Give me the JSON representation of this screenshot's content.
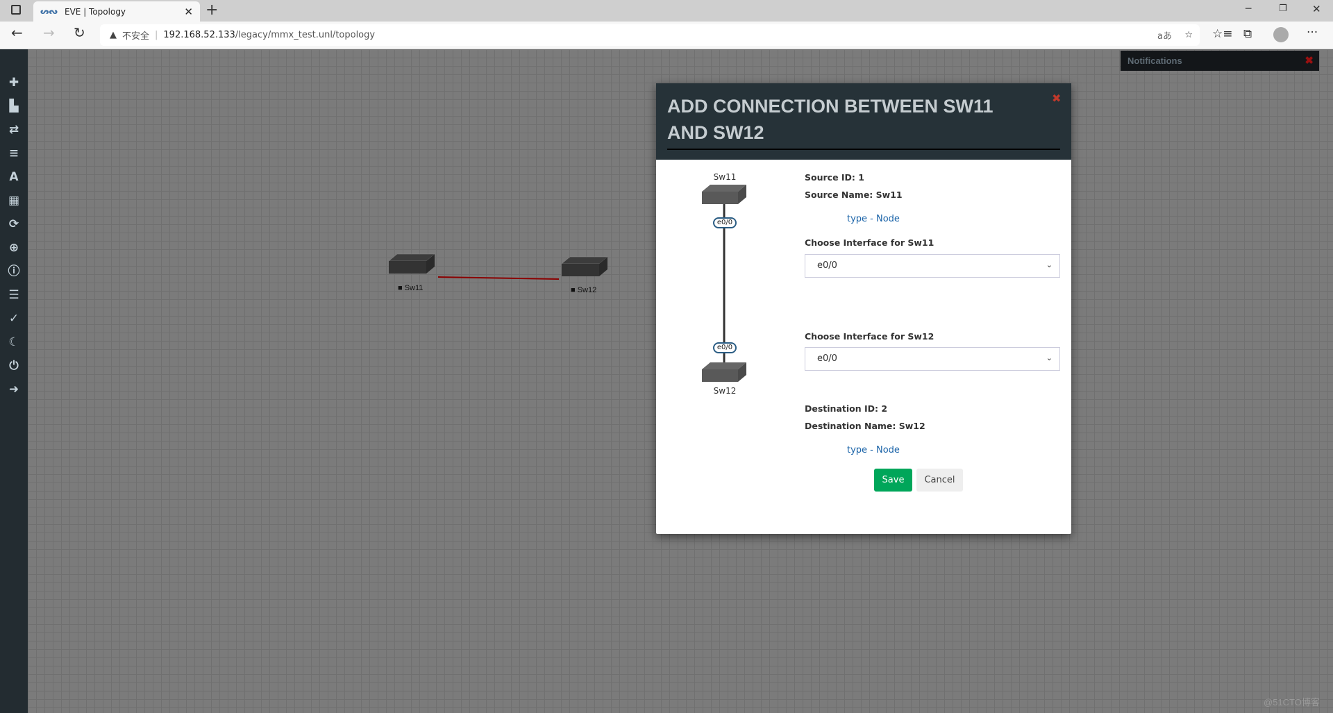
{
  "browser": {
    "tab_title": "EVE | Topology",
    "url_warning": "不安全",
    "url_host": "192.168.52.133",
    "url_path": "/legacy/mmx_test.unl/topology"
  },
  "sidebar": {
    "icons": [
      "plus-icon",
      "hdd-icon",
      "exchange-icon",
      "align-left-icon",
      "font-icon",
      "th-icon",
      "refresh-icon",
      "zoom-in-icon",
      "info-icon",
      "list-icon",
      "check-circle-icon",
      "moon-icon",
      "power-icon",
      "sign-out-icon"
    ]
  },
  "notifications": {
    "title": "Notifications"
  },
  "topology": {
    "nodes": [
      {
        "name": "Sw11"
      },
      {
        "name": "Sw12"
      }
    ],
    "link_color": "#8b0000"
  },
  "modal": {
    "title": "ADD CONNECTION BETWEEN SW11 AND SW12",
    "source_node": "Sw11",
    "dest_node": "Sw12",
    "source_port": "e0/0",
    "dest_port": "e0/0",
    "source_id": "Source ID: 1",
    "source_name": "Source Name: Sw11",
    "source_type": "type - Node",
    "choose_src_label": "Choose Interface for Sw11",
    "choose_src_value": "e0/0",
    "choose_dst_label": "Choose Interface for Sw12",
    "choose_dst_value": "e0/0",
    "dest_id": "Destination ID: 2",
    "dest_name": "Destination Name: Sw12",
    "dest_type": "type - Node",
    "save": "Save",
    "cancel": "Cancel",
    "save_color": "#00a65a"
  },
  "watermark": "@51CTO博客"
}
